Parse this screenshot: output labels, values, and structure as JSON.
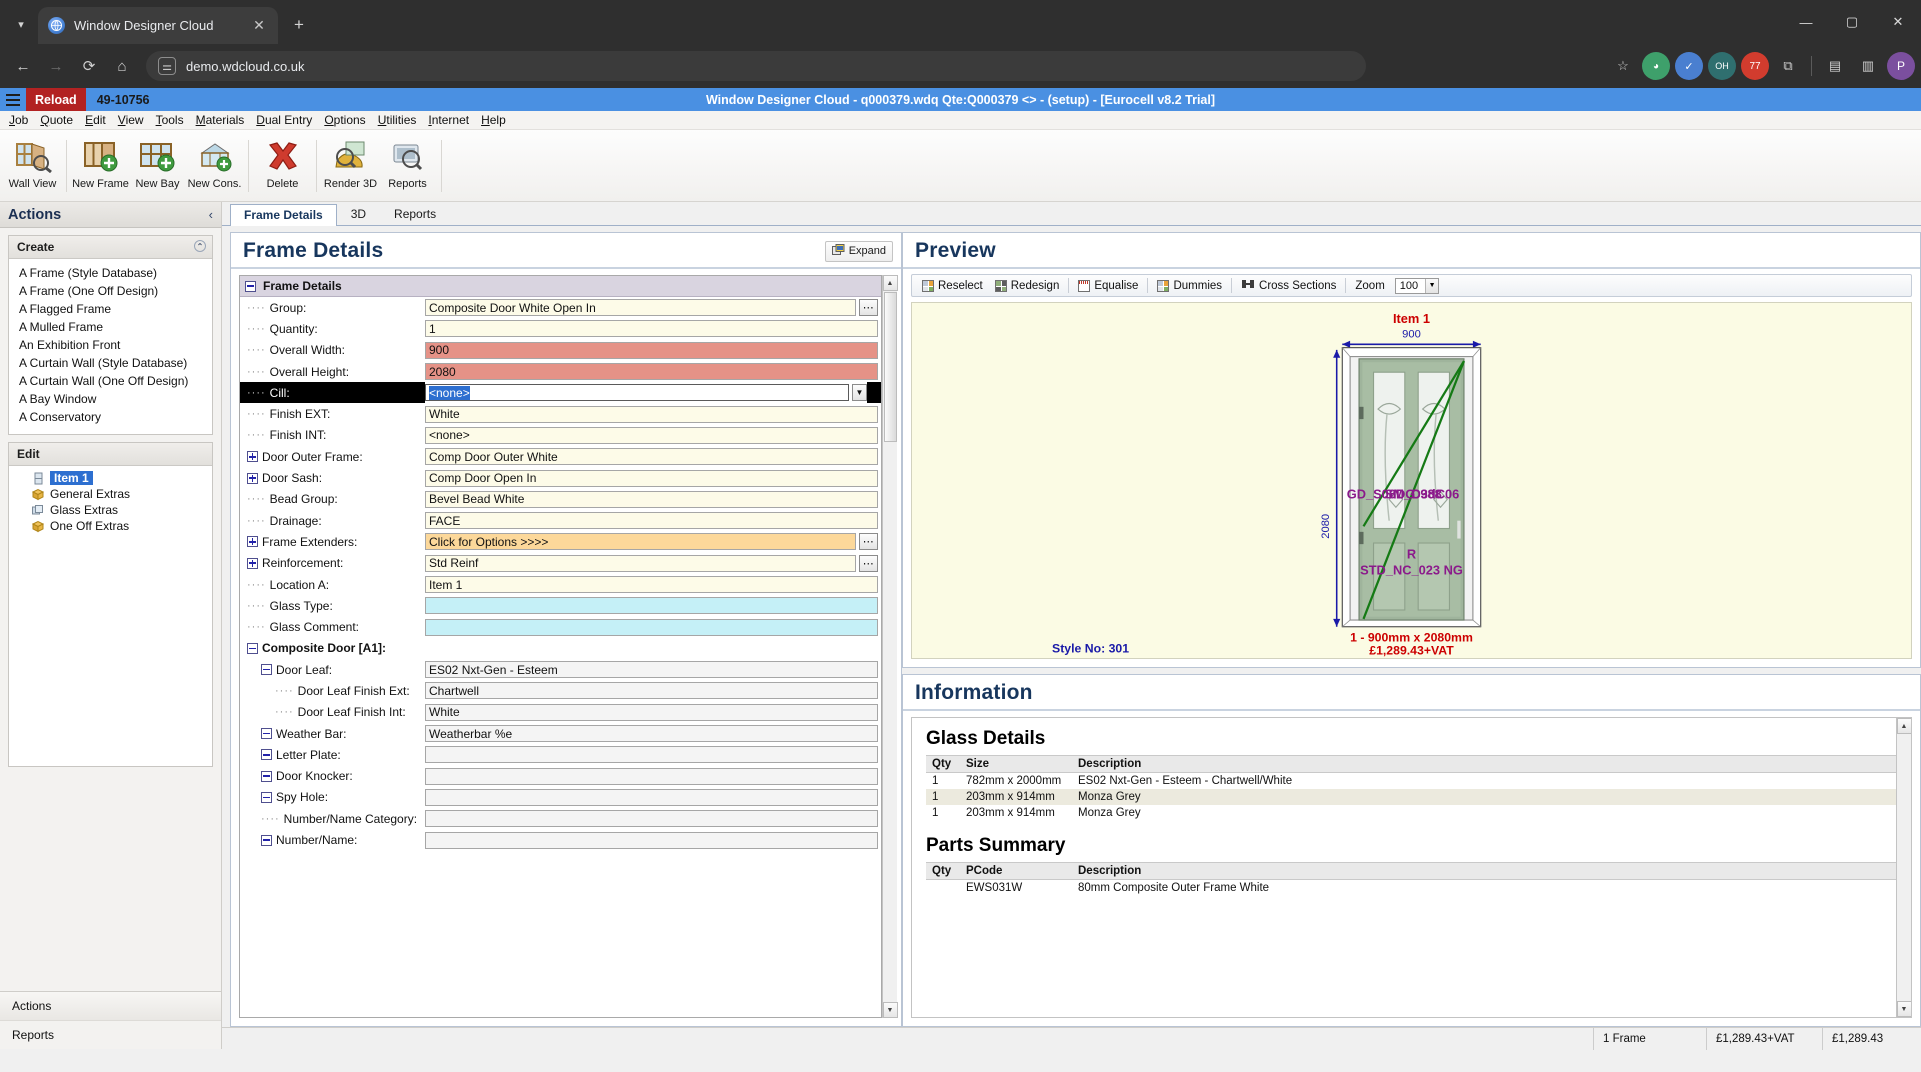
{
  "browser": {
    "tab_title": "Window Designer Cloud",
    "new_tab_label": "+",
    "close_label": "✕",
    "url": "demo.wdcloud.co.uk",
    "back_icon": "←",
    "forward_icon": "→",
    "reload_icon": "⟳",
    "home_icon": "⌂",
    "site_info_icon": "site-settings-icon",
    "star_icon": "☆",
    "minimize": "—",
    "maximize": "▢",
    "close_win": "✕",
    "ext_icons": [
      "extensions-icon",
      "profile-icon"
    ],
    "profile_letter": "P"
  },
  "app": {
    "reload_label": "Reload",
    "job_number": "49-10756",
    "title": "Window Designer Cloud - q000379.wdq Qte:Q000379 <> - (setup) - [Eurocell v8.2 Trial]",
    "menus": [
      "Job",
      "Quote",
      "Edit",
      "View",
      "Tools",
      "Materials",
      "Dual Entry",
      "Options",
      "Utilities",
      "Internet",
      "Help"
    ],
    "ribbon": [
      {
        "label": "Wall View",
        "icon": "wall-view-icon"
      },
      {
        "label": "New Frame",
        "icon": "new-frame-icon"
      },
      {
        "label": "New Bay",
        "icon": "new-bay-icon"
      },
      {
        "label": "New Cons.",
        "icon": "new-conservatory-icon"
      },
      {
        "label": "Delete",
        "icon": "delete-icon"
      },
      {
        "label": "Render 3D",
        "icon": "render-3d-icon"
      },
      {
        "label": "Reports",
        "icon": "reports-icon"
      }
    ]
  },
  "actions": {
    "header": "Actions",
    "collapse_icon": "‹",
    "create_title": "Create",
    "create_items": [
      "A Frame (Style Database)",
      "A Frame (One Off Design)",
      "A Flagged Frame",
      "A Mulled Frame",
      "An Exhibition Front",
      "A Curtain Wall (Style Database)",
      "A Curtain Wall (One Off Design)",
      "A Bay Window",
      "A Conservatory"
    ],
    "edit_title": "Edit",
    "tree": [
      {
        "label": "Item 1",
        "icon": "frame-icon",
        "selected": true
      },
      {
        "label": "General Extras",
        "icon": "box-icon",
        "selected": false
      },
      {
        "label": "Glass Extras",
        "icon": "glass-stack-icon",
        "selected": false
      },
      {
        "label": "One Off Extras",
        "icon": "box-icon",
        "selected": false
      }
    ],
    "footer_actions": "Actions",
    "footer_reports": "Reports"
  },
  "tabs": [
    {
      "label": "Frame Details",
      "active": true
    },
    {
      "label": "3D",
      "active": false
    },
    {
      "label": "Reports",
      "active": false
    }
  ],
  "frame_details": {
    "panel_title": "Frame Details",
    "expand_label": "Expand",
    "section_label": "Frame Details",
    "rows": [
      {
        "label": "Group:",
        "value": "Composite Door White Open In",
        "style": "cream",
        "indent": 0,
        "node": "dash",
        "dots": true
      },
      {
        "label": "Quantity:",
        "value": "1",
        "style": "cream",
        "indent": 0,
        "node": "dash"
      },
      {
        "label": "Overall Width:",
        "value": "900",
        "style": "red",
        "indent": 0,
        "node": "dash"
      },
      {
        "label": "Overall Height:",
        "value": "2080",
        "style": "red",
        "indent": 0,
        "node": "dash"
      },
      {
        "label": "Cill:",
        "value": "<none>",
        "style": "selected",
        "indent": 0,
        "node": "dash",
        "selected": true,
        "caret": true
      },
      {
        "label": "Finish EXT:",
        "value": "White",
        "style": "cream",
        "indent": 0,
        "node": "dash"
      },
      {
        "label": "Finish INT:",
        "value": "<none>",
        "style": "cream",
        "indent": 0,
        "node": "dash"
      },
      {
        "label": "Door Outer Frame:",
        "value": "Comp Door Outer White",
        "style": "cream",
        "indent": 0,
        "node": "plus"
      },
      {
        "label": "Door Sash:",
        "value": "Comp Door Open In",
        "style": "cream",
        "indent": 0,
        "node": "plus"
      },
      {
        "label": "Bead Group:",
        "value": "Bevel Bead White",
        "style": "cream",
        "indent": 0,
        "node": "dash"
      },
      {
        "label": "Drainage:",
        "value": "FACE",
        "style": "cream",
        "indent": 0,
        "node": "dash"
      },
      {
        "label": "Frame Extenders:",
        "value": "Click for Options >>>>",
        "style": "orange",
        "indent": 0,
        "node": "plus",
        "dots": true
      },
      {
        "label": "Reinforcement:",
        "value": "Std Reinf",
        "style": "cream",
        "indent": 0,
        "node": "plus",
        "dots": true
      },
      {
        "label": "Location A:",
        "value": "Item 1",
        "style": "cream",
        "indent": 0,
        "node": "dash"
      },
      {
        "label": "Glass Type:",
        "value": "",
        "style": "cyan",
        "indent": 0,
        "node": "dash"
      },
      {
        "label": "Glass Comment:",
        "value": "",
        "style": "cyan",
        "indent": 0,
        "node": "dash"
      },
      {
        "label": "Composite Door [A1]:",
        "value": null,
        "style": "none",
        "indent": 0,
        "node": "minus",
        "bold": true
      },
      {
        "label": "Door Leaf:",
        "value": "ES02 Nxt-Gen - Esteem",
        "style": "grey",
        "indent": 1,
        "node": "minus"
      },
      {
        "label": "Door Leaf Finish Ext:",
        "value": "Chartwell",
        "style": "grey",
        "indent": 2,
        "node": "dash"
      },
      {
        "label": "Door Leaf Finish Int:",
        "value": "White",
        "style": "grey",
        "indent": 2,
        "node": "dash"
      },
      {
        "label": "Weather Bar:",
        "value": "Weatherbar %e",
        "style": "grey",
        "indent": 1,
        "node": "minus"
      },
      {
        "label": "Letter Plate:",
        "value": "",
        "style": "grey",
        "indent": 1,
        "node": "minus"
      },
      {
        "label": "Door Knocker:",
        "value": "",
        "style": "grey",
        "indent": 1,
        "node": "minus"
      },
      {
        "label": "Spy Hole:",
        "value": "",
        "style": "grey",
        "indent": 1,
        "node": "minus"
      },
      {
        "label": "Number/Name Category:",
        "value": "",
        "style": "grey",
        "indent": 1,
        "node": "dash"
      },
      {
        "label": "Number/Name:",
        "value": "",
        "style": "grey",
        "indent": 1,
        "node": "minus"
      }
    ]
  },
  "preview": {
    "panel_title": "Preview",
    "toolbar": [
      {
        "label": "Reselect",
        "icon": "reselect-icon"
      },
      {
        "label": "Redesign",
        "icon": "redesign-icon"
      },
      {
        "label": "Equalise",
        "icon": "equalise-icon"
      },
      {
        "label": "Dummies",
        "icon": "dummies-icon"
      },
      {
        "label": "Cross Sections",
        "icon": "cross-sections-icon"
      }
    ],
    "zoom_label": "Zoom",
    "zoom_value": "100",
    "item_label": "Item 1",
    "width_label": "900",
    "height_label": "2080",
    "style_no": "Style No: 301",
    "size_line": "1 - 900mm x 2080mm",
    "price_line": "£1,289.43+VAT",
    "glass_code_left": "GD_S08DG",
    "glass_code_right": "C988D3dC06",
    "glass_code_mid": "SM_C988",
    "handing": "R",
    "door_code": "STD_NC_023 NG"
  },
  "information": {
    "panel_title": "Information",
    "glass": {
      "title": "Glass Details",
      "columns": [
        "Qty",
        "Size",
        "Description"
      ],
      "rows": [
        [
          "1",
          "782mm x 2000mm",
          "ES02 Nxt-Gen - Esteem - Chartwell/White"
        ],
        [
          "1",
          "203mm x 914mm",
          "Monza Grey"
        ],
        [
          "1",
          "203mm x 914mm",
          "Monza Grey"
        ]
      ]
    },
    "parts": {
      "title": "Parts Summary",
      "columns": [
        "Qty",
        "PCode",
        "Description"
      ],
      "rows": [
        [
          "",
          "EWS031W",
          "80mm Composite Outer Frame White"
        ]
      ]
    }
  },
  "statusbar": {
    "frames": "1 Frame",
    "total_vat": "£1,289.43+VAT",
    "total": "£1,289.43"
  }
}
